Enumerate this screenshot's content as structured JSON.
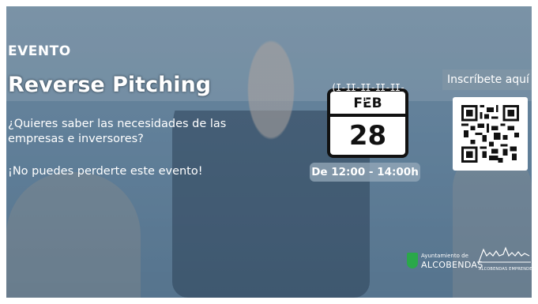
{
  "event": {
    "label": "EVENTO",
    "title": "Reverse Pitching",
    "question": "¿Quieres saber las necesidades de las empresas e inversores?",
    "cta": "¡No puedes perderte este evento!"
  },
  "calendar": {
    "month": "FEB",
    "day": "28",
    "rings": "(I-II-II-II-II-I)",
    "time": "De 12:00 - 14:00h"
  },
  "registration": {
    "label": "Inscríbete aquí"
  },
  "logos": {
    "ayuntamiento_line1": "Ayuntamiento de",
    "ayuntamiento_line2": "ALCOBENDAS",
    "emprende": "ALCOBENDAS EMPRENDE"
  },
  "colors": {
    "overlay": "#6d8ea7",
    "text": "#ffffff",
    "calendar_border": "#111111",
    "ayto_green": "#2aa84a"
  }
}
